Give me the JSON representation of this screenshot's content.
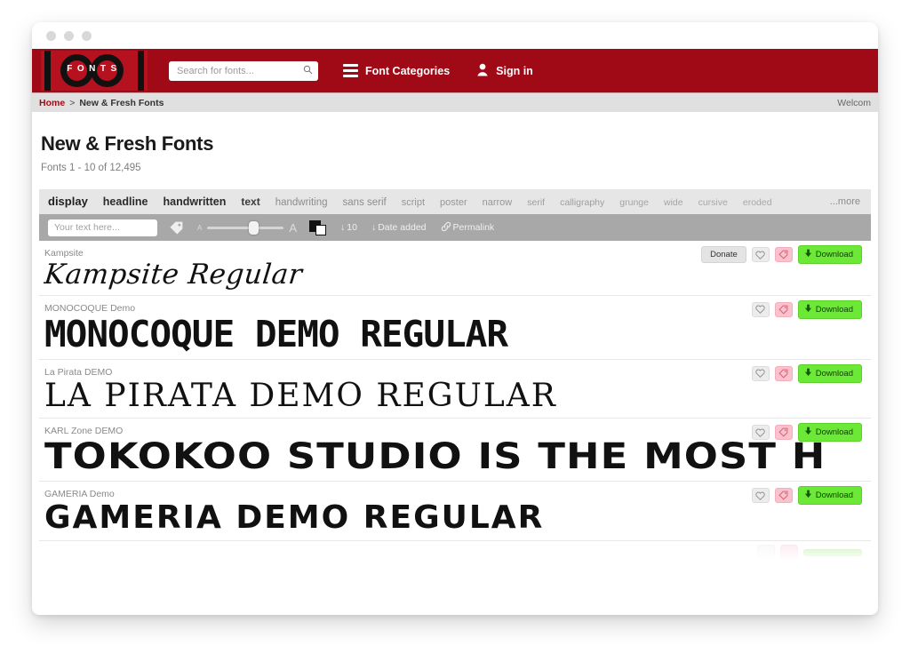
{
  "window": {
    "dots": [
      "close-dot",
      "minimize-dot",
      "maximize-dot"
    ]
  },
  "header": {
    "logo_text": "FONTS",
    "logo_name": "1001 Fonts",
    "brand_color": "#a00a17",
    "search": {
      "placeholder": "Search for fonts...",
      "value": "",
      "icon": "search-icon"
    },
    "categories_label": "Font Categories",
    "signin_label": "Sign in"
  },
  "breadcrumb": {
    "home": "Home",
    "separator": ">",
    "current": "New & Fresh Fonts",
    "welcome": "Welcom"
  },
  "page": {
    "title": "New & Fresh Fonts",
    "result_count": "Fonts 1 - 10 of 12,495"
  },
  "tagcloud": {
    "tags": [
      {
        "label": "display",
        "size": 13,
        "weight": "bold",
        "color": "#1f1f1f"
      },
      {
        "label": "headline",
        "size": 12.5,
        "weight": "bold",
        "color": "#2b2b2b"
      },
      {
        "label": "handwritten",
        "size": 12.5,
        "weight": "bold",
        "color": "#2b2b2b"
      },
      {
        "label": "text",
        "size": 12,
        "weight": "bold",
        "color": "#3a3a3a"
      },
      {
        "label": "handwriting",
        "size": 11.5,
        "weight": "normal",
        "color": "#8c8c8c"
      },
      {
        "label": "sans serif",
        "size": 11.5,
        "weight": "normal",
        "color": "#8c8c8c"
      },
      {
        "label": "script",
        "size": 11,
        "weight": "normal",
        "color": "#969696"
      },
      {
        "label": "poster",
        "size": 11,
        "weight": "normal",
        "color": "#969696"
      },
      {
        "label": "narrow",
        "size": 11,
        "weight": "normal",
        "color": "#969696"
      },
      {
        "label": "serif",
        "size": 10.5,
        "weight": "normal",
        "color": "#9e9e9e"
      },
      {
        "label": "calligraphy",
        "size": 10.5,
        "weight": "normal",
        "color": "#9e9e9e"
      },
      {
        "label": "grunge",
        "size": 10.5,
        "weight": "normal",
        "color": "#a4a4a4"
      },
      {
        "label": "wide",
        "size": 10.5,
        "weight": "normal",
        "color": "#a4a4a4"
      },
      {
        "label": "cursive",
        "size": 10.5,
        "weight": "normal",
        "color": "#a8a8a8"
      },
      {
        "label": "eroded",
        "size": 10.5,
        "weight": "normal",
        "color": "#a8a8a8"
      }
    ],
    "more_label": "...more"
  },
  "toolbar": {
    "preview_input": {
      "placeholder": "Your text here...",
      "value": ""
    },
    "tag_icon": "tag-icon",
    "size_slider": {
      "small_label": "A",
      "large_label": "A",
      "value": 55
    },
    "color_icon": "color-swatch-icon",
    "per_page": {
      "icon": "down-arrow",
      "label": "10"
    },
    "sort": {
      "icon": "down-arrow",
      "label": "Date added"
    },
    "permalink": {
      "icon": "link-icon",
      "label": "Permalink"
    }
  },
  "buttons": {
    "donate": "Donate",
    "download": "Download",
    "favorite_icon": "heart-icon",
    "tag_icon": "tag-icon",
    "download_icon": "download-arrow-icon"
  },
  "font_list": [
    {
      "name": "Kampsite",
      "preview": "Kampsite Regular",
      "style": "pv-script",
      "has_donate": true
    },
    {
      "name": "MONOCOQUE Demo",
      "preview": "MONOCOQUE DEMO REGULAR",
      "style": "pv-mono-bold",
      "has_donate": false
    },
    {
      "name": "La Pirata DEMO",
      "preview": "LA PIRATA DEMO REGULAR",
      "style": "pv-thin-serif",
      "has_donate": false
    },
    {
      "name": "KARL Zone DEMO",
      "preview": "TOKOKOO STUDIO IS THE MOST H",
      "style": "pv-block",
      "has_donate": false
    },
    {
      "name": "GAMERIA Demo",
      "preview": "GAMERIA DEMO REGULAR",
      "style": "pv-slab",
      "has_donate": false
    }
  ]
}
